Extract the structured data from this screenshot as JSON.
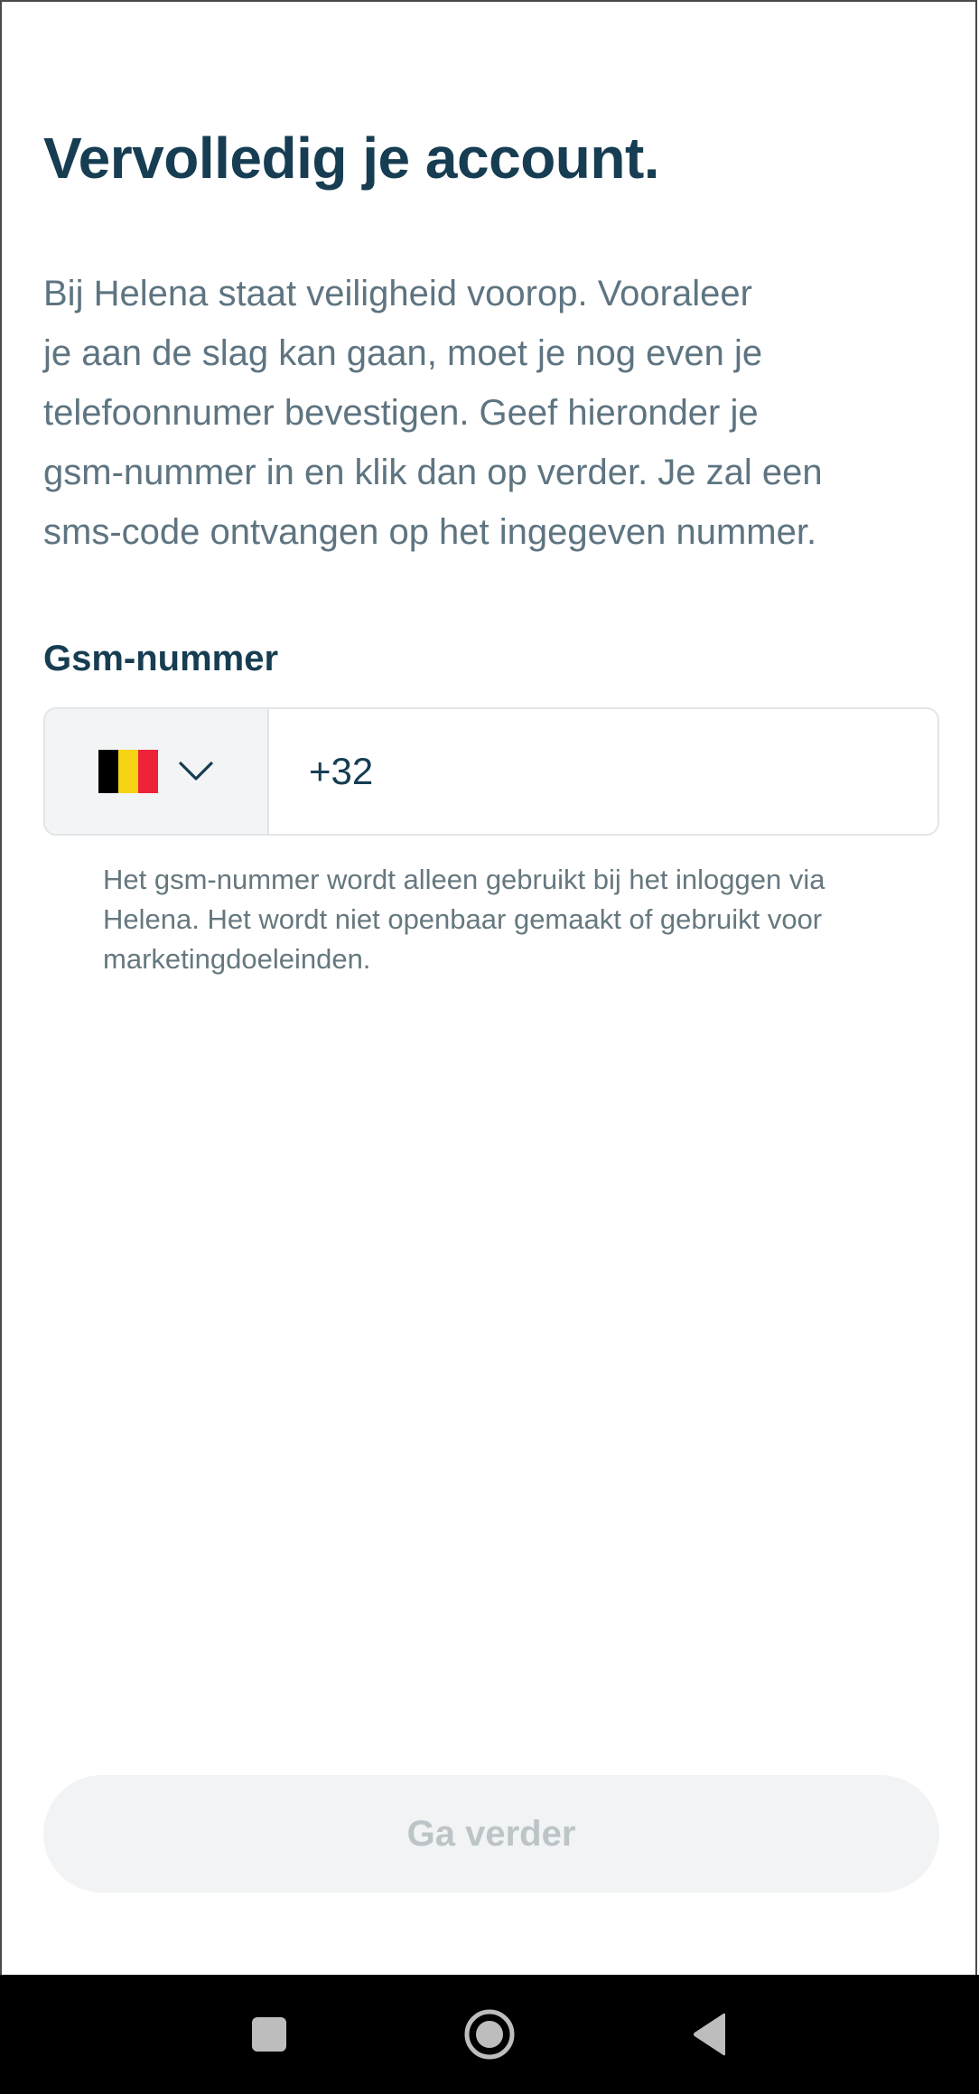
{
  "page": {
    "title": "Vervolledig je account.",
    "intro_lines": [
      "Bij Helena staat veiligheid voorop. Vooraleer",
      "je aan de slag kan gaan, moet je nog even je",
      "telefoonnumer bevestigen. Geef hieronder je",
      "gsm-nummer in en klik dan op verder. Je zal een",
      "sms-code ontvangen op het ingegeven nummer."
    ]
  },
  "phone_field": {
    "label": "Gsm-nummer",
    "country_flag": "belgium-flag-icon",
    "dropdown_icon": "chevron-down-icon",
    "value": "+32",
    "helper_lines": [
      "Het gsm-nummer wordt alleen gebruikt bij het inloggen via",
      "Helena. Het wordt niet openbaar gemaakt of gebruikt voor",
      "marketingdoeleinden."
    ]
  },
  "actions": {
    "continue_label": "Ga verder"
  },
  "nav_bar": {
    "recent_icon": "square-icon",
    "home_icon": "circle-home-icon",
    "back_icon": "triangle-back-icon"
  },
  "colors": {
    "heading": "#163d52",
    "body_text": "#5e7481",
    "button_disabled_bg": "#f1f3f4",
    "button_disabled_text": "#bcc4c8",
    "flag_black": "#000000",
    "flag_yellow": "#f5d313",
    "flag_red": "#ee2238"
  }
}
